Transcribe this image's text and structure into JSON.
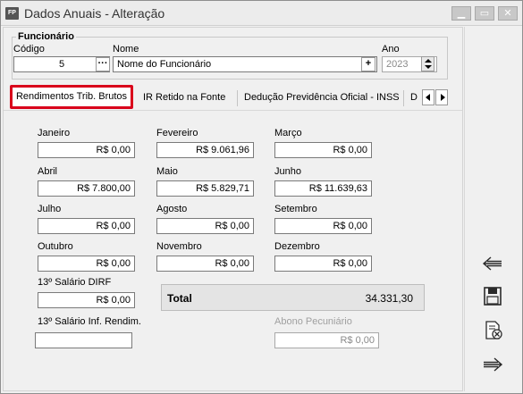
{
  "window": {
    "app_icon": "FP",
    "title": "Dados Anuais - Alteração"
  },
  "funcionario": {
    "group_title": "Funcionário",
    "codigo_label": "Código",
    "codigo_value": "5",
    "codigo_button": "···",
    "nome_label": "Nome",
    "nome_value": "Nome do Funcionário",
    "nome_button": "+",
    "ano_label": "Ano",
    "ano_value": "2023"
  },
  "tabs": {
    "items": [
      "Rendimentos Trib. Brutos",
      "IR Retido na Fonte",
      "Dedução Previdência Oficial - INSS",
      "D"
    ],
    "active_index": 0
  },
  "months": [
    {
      "label": "Janeiro",
      "value": "R$ 0,00"
    },
    {
      "label": "Fevereiro",
      "value": "R$ 9.061,96"
    },
    {
      "label": "Março",
      "value": "R$ 0,00"
    },
    {
      "label": "Abril",
      "value": "R$ 7.800,00"
    },
    {
      "label": "Maio",
      "value": "R$ 5.829,71"
    },
    {
      "label": "Junho",
      "value": "R$ 11.639,63"
    },
    {
      "label": "Julho",
      "value": "R$ 0,00"
    },
    {
      "label": "Agosto",
      "value": "R$ 0,00"
    },
    {
      "label": "Setembro",
      "value": "R$ 0,00"
    },
    {
      "label": "Outubro",
      "value": "R$ 0,00"
    },
    {
      "label": "Novembro",
      "value": "R$ 0,00"
    },
    {
      "label": "Dezembro",
      "value": "R$ 0,00"
    }
  ],
  "extras": {
    "salario13_dirf_label": "13º Salário DIRF",
    "salario13_dirf_value": "R$ 0,00",
    "salario13_inf_label": "13º Salário Inf. Rendim.",
    "salario13_inf_value": "",
    "abono_label": "Abono Pecuniário",
    "abono_value": "R$ 0,00"
  },
  "total": {
    "label": "Total",
    "value": "34.331,30"
  },
  "side_actions": [
    "back-arrow-icon",
    "save-icon",
    "delete-document-icon",
    "forward-arrow-icon"
  ]
}
